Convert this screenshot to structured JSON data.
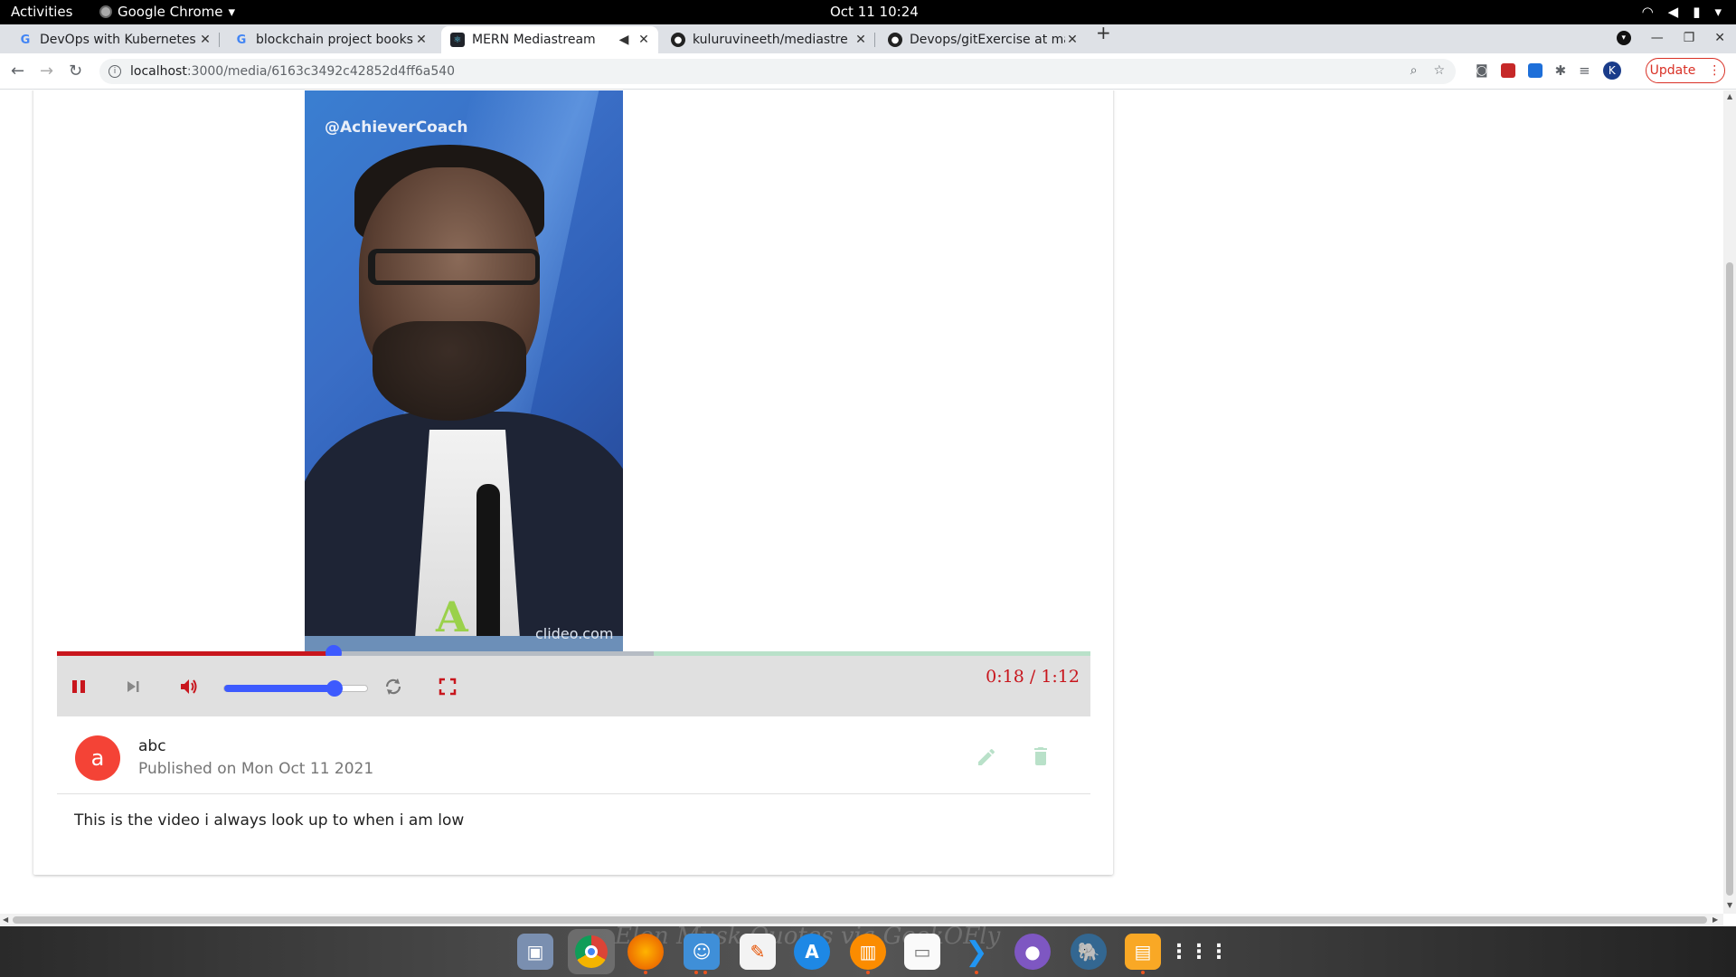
{
  "system_bar": {
    "activities": "Activities",
    "app_name": "Google Chrome",
    "clock": "Oct 11  10:24"
  },
  "tabs": [
    {
      "label": "DevOps with Kubernetes",
      "icon": "google-icon",
      "active": false
    },
    {
      "label": "blockchain project books",
      "icon": "google-icon",
      "active": false
    },
    {
      "label": "MERN Mediastream",
      "icon": "react-icon",
      "active": true
    },
    {
      "label": "kuluruvineeth/mediastre",
      "icon": "github-icon",
      "active": false
    },
    {
      "label": "Devops/gitExercise at ma",
      "icon": "github-icon",
      "active": false
    }
  ],
  "address_bar": {
    "host": "localhost",
    "path": ":3000/media/6163c3492c42852d4ff6a540"
  },
  "toolbar": {
    "profile_initial": "K",
    "update_label": "Update"
  },
  "player": {
    "watermark": "@AchieverCoach",
    "brand": "clideo.com",
    "time_readout": "0:18 / 1:12",
    "played_fraction": 0.268,
    "buffered_fraction": 0.577,
    "volume_fraction": 0.77,
    "colors": {
      "played": "#c8161d",
      "thumb": "#3d5afe",
      "track": "#b9e1c9"
    }
  },
  "media": {
    "author_initial": "a",
    "author_name": "abc",
    "published": "Published on Mon Oct 11 2021",
    "description": "This is the video i always look up to when i am low"
  },
  "dock": {
    "background_text": "Elon Musk Quotes via GeekOFly",
    "apps": [
      "terminal-icon",
      "chrome-icon",
      "firefox-icon",
      "files-icon",
      "text-editor-icon",
      "app-store-icon",
      "books-icon",
      "notes-icon",
      "vscode-icon",
      "github-desktop-icon",
      "postgres-icon",
      "archive-icon",
      "app-grid-icon"
    ]
  }
}
